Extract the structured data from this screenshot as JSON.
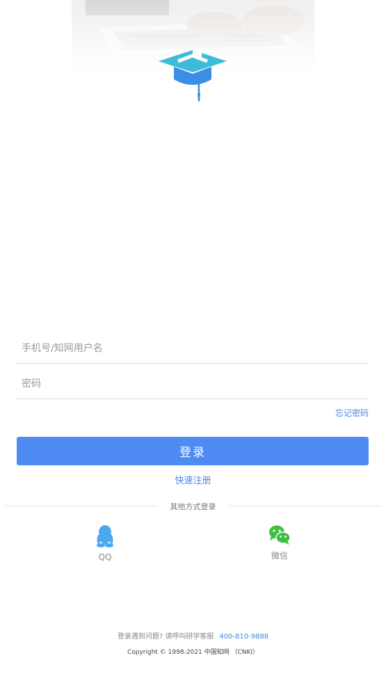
{
  "form": {
    "username_placeholder": "手机号/知网用户名",
    "password_placeholder": "密码",
    "forgot_label": "忘记密码",
    "login_label": "登录",
    "register_label": "快速注册"
  },
  "other_login": {
    "divider_text": "其他方式登录",
    "qq_label": "QQ",
    "wechat_label": "微信"
  },
  "footer": {
    "help_text": "登录遇到问题?  请呼叫研学客服",
    "phone": "400-810-9888",
    "copyright": "Copyright © 1998-2021 中国知网 （CNKI）"
  },
  "colors": {
    "primary": "#4e8cf3",
    "link": "#4a86e0",
    "qq": "#4aa8ee",
    "wechat": "#3ebf3f",
    "logo_cyan": "#3cbcd9",
    "logo_blue": "#3a8ee6"
  }
}
